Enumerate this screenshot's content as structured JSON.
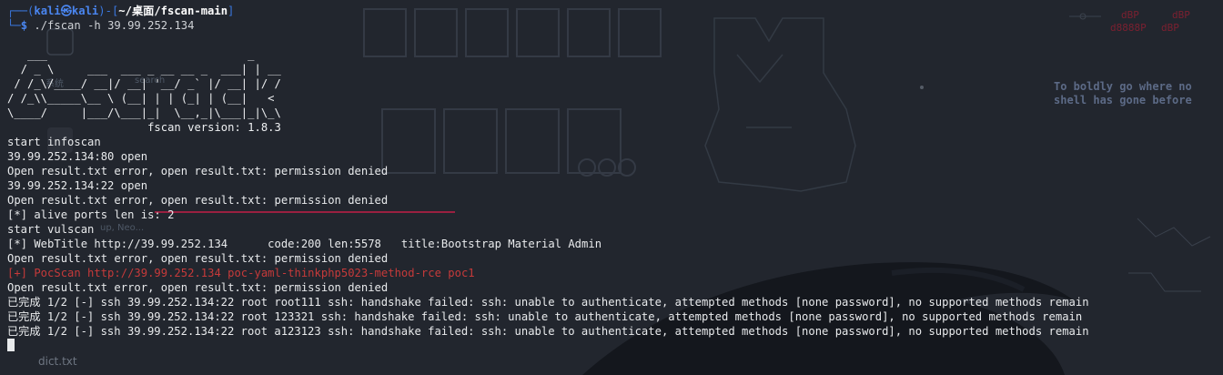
{
  "prompt": {
    "user": "kali",
    "at": "㉿",
    "host": "kali",
    "path": "~/桌面/fscan-main",
    "command": "./fscan -h 39.99.252.134"
  },
  "banner": [
    "   ___                              _",
    "  / _ \\     ___  ___ _ __ __ _  ___| | __",
    " / /_\\/____/ __|/ __| '__/ _` |/ __| |/ /",
    "/ /_\\\\_____\\__ \\ (__| | | (_| | (__|   <",
    "\\____/     |___/\\___|_|  \\__,_|\\___|_|\\_\\",
    "                     fscan version: 1.8.3"
  ],
  "output": [
    {
      "text": "start infoscan",
      "style": "normal"
    },
    {
      "text": "39.99.252.134:80 open",
      "style": "normal"
    },
    {
      "text": "Open result.txt error, open result.txt: permission denied",
      "style": "normal"
    },
    {
      "text": "39.99.252.134:22 open",
      "style": "normal"
    },
    {
      "text": "Open result.txt error, open result.txt: permission denied",
      "style": "normal"
    },
    {
      "text": "[*] alive ports len is: 2",
      "style": "normal"
    },
    {
      "text": "start vulscan",
      "style": "normal"
    },
    {
      "text": "[*] WebTitle http://39.99.252.134      code:200 len:5578   title:Bootstrap Material Admin",
      "style": "normal"
    },
    {
      "text": "Open result.txt error, open result.txt: permission denied",
      "style": "normal"
    },
    {
      "text": "[+] PocScan http://39.99.252.134 poc-yaml-thinkphp5023-method-rce poc1",
      "style": "red"
    },
    {
      "text": "Open result.txt error, open result.txt: permission denied",
      "style": "normal"
    },
    {
      "text": "已完成 1/2 [-] ssh 39.99.252.134:22 root root111 ssh: handshake failed: ssh: unable to authenticate, attempted methods [none password], no supported methods remain",
      "style": "normal"
    },
    {
      "text": "已完成 1/2 [-] ssh 39.99.252.134:22 root 123321 ssh: handshake failed: ssh: unable to authenticate, attempted methods [none password], no supported methods remain",
      "style": "normal"
    },
    {
      "text": "已完成 1/2 [-] ssh 39.99.252.134:22 root a123123 ssh: handshake failed: ssh: unable to authenticate, attempted methods [none password], no supported methods remain",
      "style": "normal"
    }
  ],
  "wallpaper": {
    "quote": [
      "To boldly go where no",
      "shell has gone before"
    ],
    "desktop_labels": {
      "sys": "系统",
      "search": "search",
      "up": "up, Neo...",
      "file": "dict.txt"
    },
    "colors": {
      "background": "#22262e",
      "red_line": "#9a2040",
      "quote": "#5c6a86"
    }
  },
  "colors": {
    "prompt_blue": "#3a78e0",
    "poc_red": "#c63a3a",
    "text": "#e8eaec"
  }
}
